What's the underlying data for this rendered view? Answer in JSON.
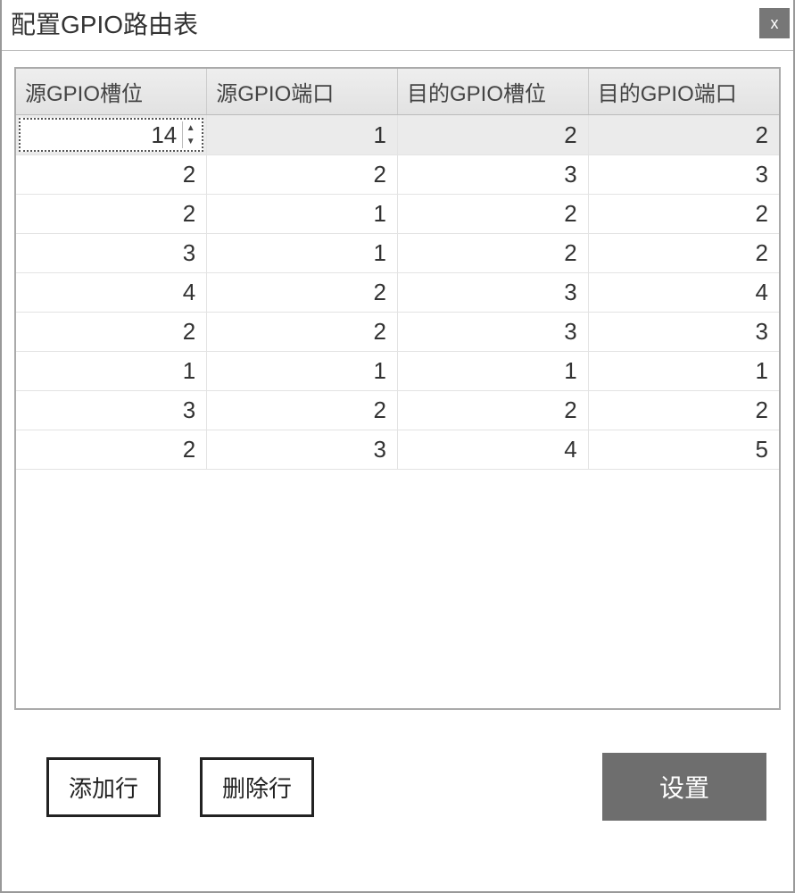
{
  "dialog": {
    "title": "配置GPIO路由表",
    "close_label": "x"
  },
  "table": {
    "headers": [
      "源GPIO槽位",
      "源GPIO端口",
      "目的GPIO槽位",
      "目的GPIO端口"
    ],
    "spinner_value": "14",
    "rows": [
      {
        "selected": true,
        "cells": [
          "14",
          "1",
          "2",
          "2"
        ]
      },
      {
        "selected": false,
        "cells": [
          "2",
          "2",
          "3",
          "3"
        ]
      },
      {
        "selected": false,
        "cells": [
          "2",
          "1",
          "2",
          "2"
        ]
      },
      {
        "selected": false,
        "cells": [
          "3",
          "1",
          "2",
          "2"
        ]
      },
      {
        "selected": false,
        "cells": [
          "4",
          "2",
          "3",
          "4"
        ]
      },
      {
        "selected": false,
        "cells": [
          "2",
          "2",
          "3",
          "3"
        ]
      },
      {
        "selected": false,
        "cells": [
          "1",
          "1",
          "1",
          "1"
        ]
      },
      {
        "selected": false,
        "cells": [
          "3",
          "2",
          "2",
          "2"
        ]
      },
      {
        "selected": false,
        "cells": [
          "2",
          "3",
          "4",
          "5"
        ]
      }
    ]
  },
  "footer": {
    "add_row": "添加行",
    "delete_row": "删除行",
    "apply": "设置"
  }
}
